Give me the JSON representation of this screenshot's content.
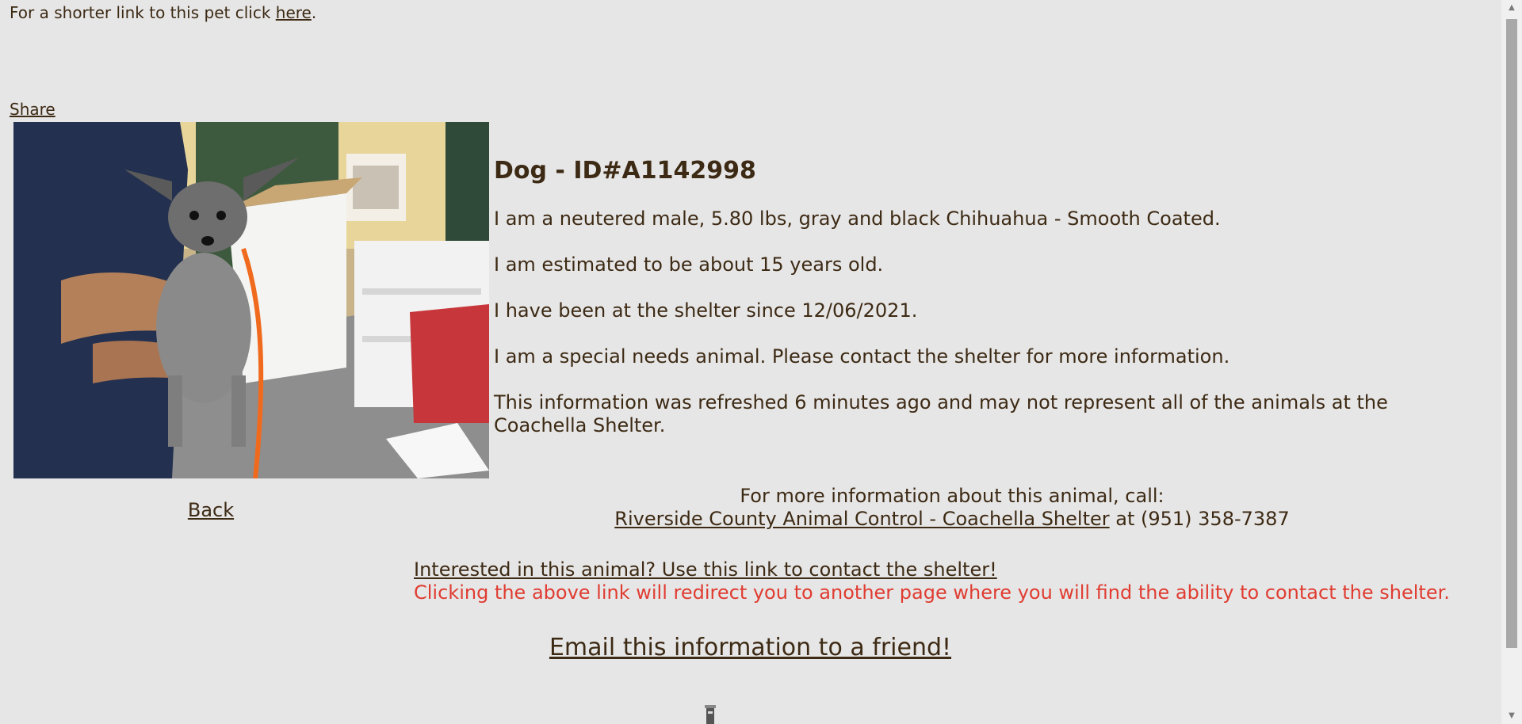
{
  "header": {
    "short_link_text": "For a shorter link to this pet click ",
    "short_link_label": "here",
    "short_link_suffix": ".",
    "share_label": "Share"
  },
  "photo": {
    "alt": "Photo of a gray and black Chihuahua held by a staff member"
  },
  "nav": {
    "back_label": "Back"
  },
  "animal": {
    "title": "Dog - ID#A1142998",
    "description": "I am a neutered male, 5.80 lbs, gray and black Chihuahua - Smooth Coated.",
    "age": "I am estimated to be about 15 years old.",
    "since": "I have been at the shelter since 12/06/2021.",
    "special_needs": "I am a special needs animal. Please contact the shelter for more information.",
    "refresh_note": "This information was refreshed 6 minutes ago and may not represent all of the animals at the Coachella Shelter."
  },
  "contact": {
    "call_prefix": "For more information about this animal, call:",
    "shelter_name": "Riverside County Animal Control - Coachella Shelter",
    "phone_text": " at (951) 358-7387",
    "interested_label": "Interested in this animal? Use this link to contact the shelter!",
    "redirect_note": "Clicking the above link will redirect you to another page where you will find the ability to contact the shelter.",
    "email_label": "Email this information to a friend!"
  },
  "colors": {
    "background": "#e6e6e6",
    "text": "#3d2a14",
    "warning": "#e03c31"
  }
}
